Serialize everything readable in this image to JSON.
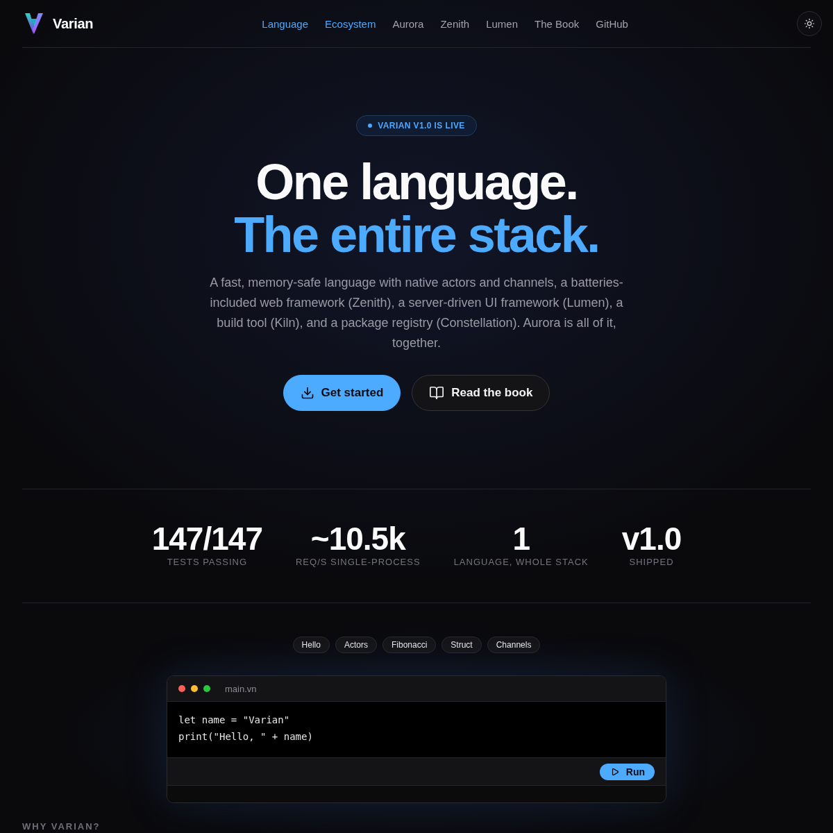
{
  "header": {
    "brand": "Varian",
    "nav": [
      {
        "label": "Language",
        "selected": true
      },
      {
        "label": "Ecosystem",
        "selected": true
      },
      {
        "label": "Aurora",
        "selected": false
      },
      {
        "label": "Zenith",
        "selected": false
      },
      {
        "label": "Lumen",
        "selected": false
      },
      {
        "label": "The Book",
        "selected": false
      },
      {
        "label": "GitHub",
        "selected": false
      }
    ]
  },
  "hero": {
    "badge": "VARIAN V1.0 IS LIVE",
    "title_line_1": "One language.",
    "title_line_2": "The entire stack.",
    "description": "A fast, memory-safe language with native actors and channels, a batteries-included web framework (Zenith), a server-driven UI framework (Lumen), a build tool (Kiln), and a package registry (Constellation). Aurora is all of it, together.",
    "buttons": [
      {
        "label": "Get started",
        "kind": "primary"
      },
      {
        "label": "Read the book",
        "kind": "secondary"
      }
    ]
  },
  "stats": [
    {
      "value": "147/147",
      "label": "TESTS PASSING"
    },
    {
      "value": "~10.5k",
      "label": "REQ/S SINGLE-PROCESS"
    },
    {
      "value": "1",
      "label": "LANGUAGE, WHOLE STACK"
    },
    {
      "value": "v1.0",
      "label": "SHIPPED"
    }
  ],
  "playground": {
    "tabs": [
      "Hello",
      "Actors",
      "Fibonacci",
      "Struct",
      "Channels"
    ],
    "window_dots": [
      {
        "color": "#ff5f57"
      },
      {
        "color": "#febc2e"
      },
      {
        "color": "#28c840"
      }
    ],
    "filename": "main.vn",
    "code": [
      "let name = \"Varian\"",
      "print(\"Hello, \" + name)"
    ],
    "run_button": "Run"
  },
  "next_section": {
    "heading": "WHY VARIAN?"
  }
}
